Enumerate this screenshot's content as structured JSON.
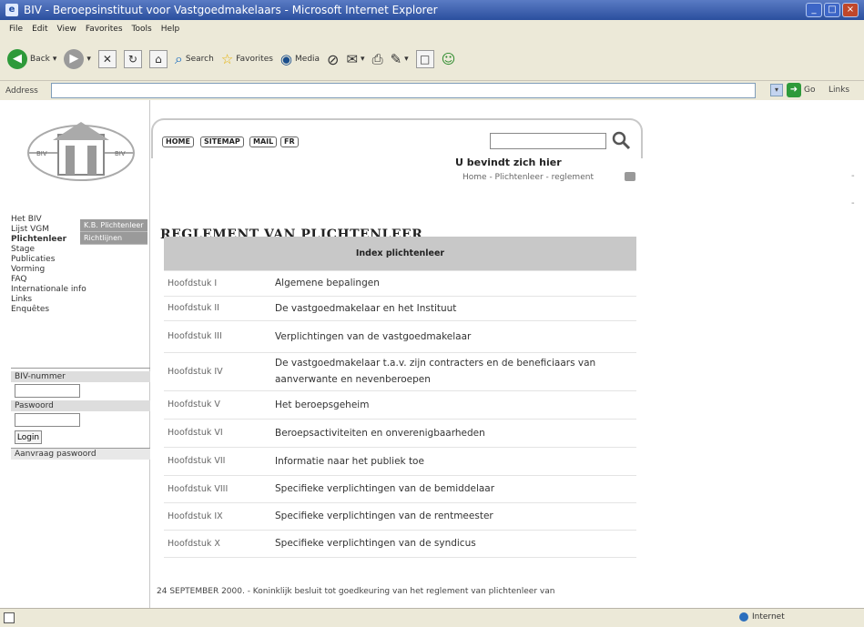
{
  "window": {
    "title": "BIV - Beroepsinstituut voor Vastgoedmakelaars - Microsoft Internet Explorer",
    "controls": {
      "minimize": "_",
      "maximize": "□",
      "close": "×"
    }
  },
  "menu": [
    "File",
    "Edit",
    "View",
    "Favorites",
    "Tools",
    "Help"
  ],
  "toolbar": {
    "back": "Back",
    "search": "Search",
    "favorites": "Favorites",
    "media": "Media"
  },
  "address": {
    "label": "Address",
    "value": "",
    "go": "Go",
    "links": "Links"
  },
  "site": {
    "logo_left_text": "BIV",
    "logo_right_text": "BIV",
    "topnav": [
      "HOME",
      "SITEMAP",
      "MAIL",
      "FR"
    ],
    "search": {
      "value": "",
      "placeholder": ""
    },
    "you_are_here": "U bevindt zich hier",
    "breadcrumb": "Home - Plichtenleer - reglement",
    "nav": [
      "Het BIV",
      "Lijst VGM",
      "Plichtenleer",
      "Stage",
      "Publicaties",
      "Vorming",
      "FAQ",
      "Internationale info",
      "Links",
      "Enquêtes"
    ],
    "flyout": [
      "K.B. Plichtenleer",
      "Richtlijnen"
    ],
    "login": {
      "biv_number_label": "BIV-nummer",
      "password_label": "Paswoord",
      "button": "Login",
      "request_password": "Aanvraag paswoord"
    },
    "heading": "REGLEMENT VAN PLICHTENLEER",
    "index_title": "Index plichtenleer",
    "chapters": [
      {
        "chapter": "Hoofdstuk I",
        "title": "Algemene bepalingen"
      },
      {
        "chapter": "Hoofdstuk II",
        "title": "De vastgoedmakelaar en het Instituut"
      },
      {
        "chapter": "Hoofdstuk III",
        "title": "Verplichtingen van de vastgoedmakelaar"
      },
      {
        "chapter": "Hoofdstuk IV",
        "title": "De vastgoedmakelaar t.a.v. zijn contracters en de beneficiaars van aanverwante en nevenberoepen"
      },
      {
        "chapter": "Hoofdstuk V",
        "title": "Het beroepsgeheim"
      },
      {
        "chapter": "Hoofdstuk VI",
        "title": "Beroepsactiviteiten en onverenigbaarheden"
      },
      {
        "chapter": "Hoofdstuk VII",
        "title": "Informatie naar het publiek toe"
      },
      {
        "chapter": "Hoofdstuk VIII",
        "title": "Specifieke verplichtingen van de bemiddelaar"
      },
      {
        "chapter": "Hoofdstuk IX",
        "title": "Specifieke verplichtingen van de rentmeester"
      },
      {
        "chapter": "Hoofdstuk X",
        "title": "Specifieke verplichtingen van de syndicus"
      }
    ],
    "footer_text": "24 SEPTEMBER 2000. - Koninklijk besluit tot goedkeuring van het reglement van plichtenleer van"
  },
  "status": {
    "zone": "Internet"
  }
}
